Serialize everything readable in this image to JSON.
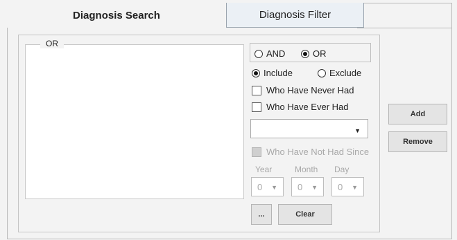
{
  "tabs": [
    {
      "label": "Diagnosis Search",
      "active": true
    },
    {
      "label": "Diagnosis Filter",
      "active": false
    }
  ],
  "group": {
    "legend": "OR"
  },
  "logic": {
    "and_label": "AND",
    "or_label": "OR",
    "selected": "OR"
  },
  "scope": {
    "include_label": "Include",
    "exclude_label": "Exclude",
    "selected": "Include"
  },
  "filters": {
    "never_had_label": "Who Have Never Had",
    "ever_had_label": "Who Have Ever Had",
    "not_had_since_label": "Who Have Not Had Since"
  },
  "diagnosis_select": {
    "value": ""
  },
  "date": {
    "year_label": "Year",
    "month_label": "Month",
    "day_label": "Day",
    "year_value": "0",
    "month_value": "0",
    "day_value": "0"
  },
  "buttons": {
    "add": "Add",
    "remove": "Remove",
    "browse": "...",
    "clear": "Clear"
  },
  "icons": {
    "dropdown": "chevron-down-icon"
  }
}
